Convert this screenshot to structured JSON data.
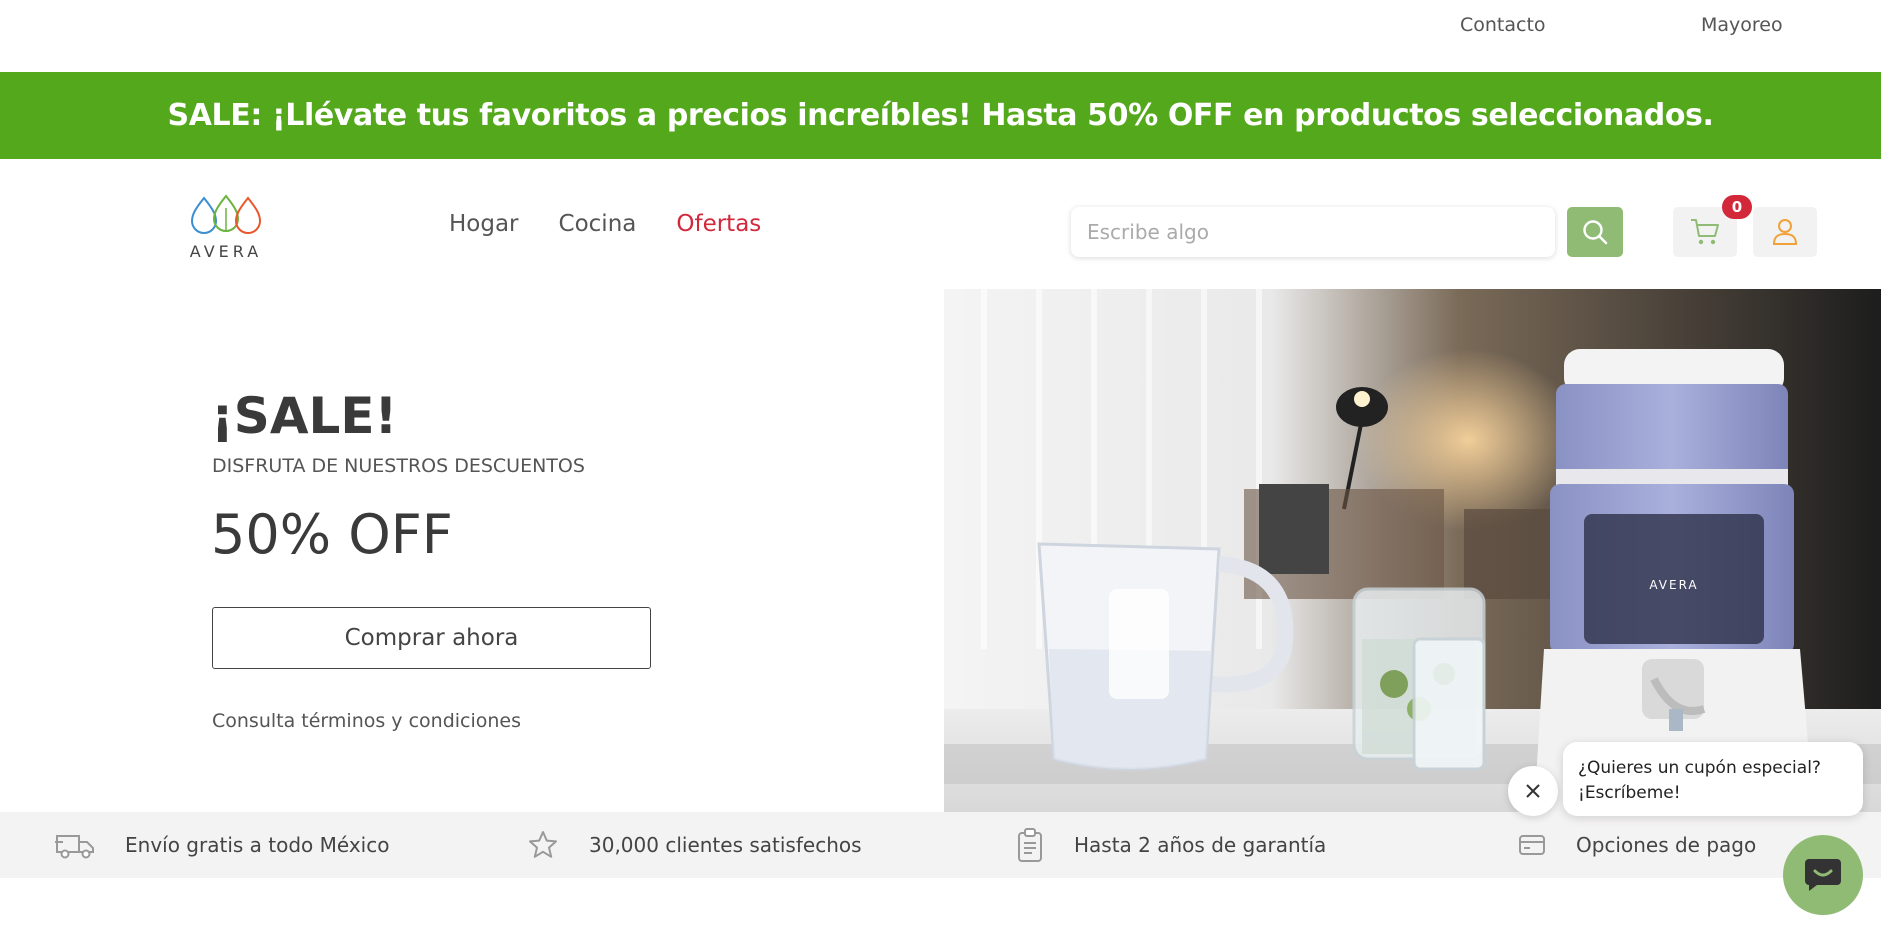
{
  "topbar": {
    "links": [
      "Contacto",
      "Mayoreo"
    ]
  },
  "promo": {
    "text": "SALE: ¡Llévate tus favoritos a precios increíbles! Hasta 50% OFF en productos seleccionados."
  },
  "header": {
    "brand": "AVERA",
    "nav": [
      "Hogar",
      "Cocina",
      "Ofertas"
    ],
    "search_placeholder": "Escribe algo",
    "cart_count": "0"
  },
  "hero": {
    "title": "¡SALE!",
    "subtitle": "DISFRUTA DE NUESTROS DESCUENTOS",
    "discount": "50% OFF",
    "cta": "Comprar ahora",
    "terms": "Consulta términos y condiciones",
    "image_brand": "AVERA"
  },
  "features": [
    {
      "label": "Envío gratis a todo México",
      "icon": "truck-icon"
    },
    {
      "label": "30,000 clientes satisfechos",
      "icon": "star-icon"
    },
    {
      "label": "Hasta 2 años de garantía",
      "icon": "clipboard-icon"
    },
    {
      "label": "Opciones de pago",
      "icon": "card-icon"
    }
  ],
  "chat": {
    "line1": "¿Quieres un cupón especial?",
    "line2": "¡Escríbeme!"
  },
  "colors": {
    "promo_green": "#54a81b",
    "accent_green": "#8fbb74",
    "offer_red": "#d2283a",
    "badge_red": "#d2283a"
  }
}
